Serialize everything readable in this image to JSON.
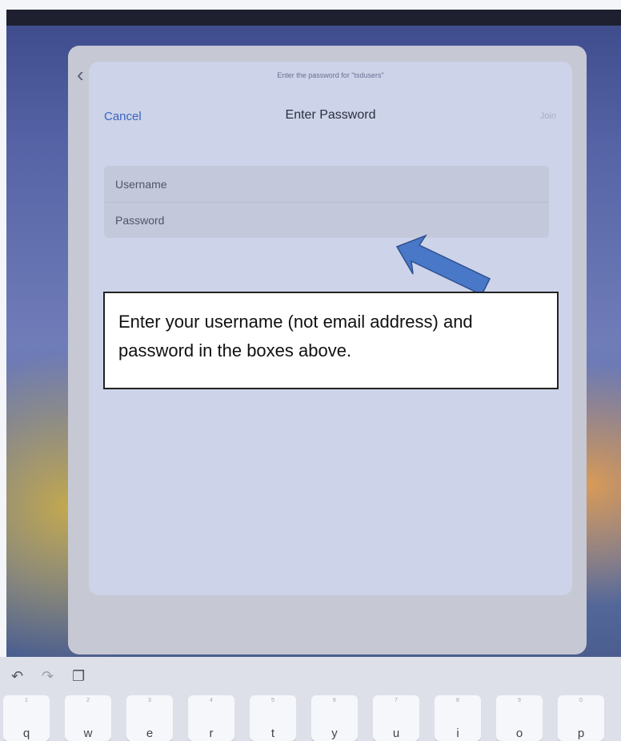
{
  "dialog": {
    "prompt": "Enter the password for \"tsdusers\"",
    "title": "Enter Password",
    "cancel_label": "Cancel",
    "join_label": "Join",
    "username_placeholder": "Username",
    "password_placeholder": "Password"
  },
  "callout": {
    "text": "Enter your username (not email address) and password in the boxes above."
  },
  "keyboard": {
    "keys": [
      "q",
      "w",
      "e",
      "r",
      "t",
      "y",
      "u",
      "i",
      "o",
      "p"
    ],
    "top_glyphs": [
      "1",
      "2",
      "3",
      "4",
      "5",
      "6",
      "7",
      "8",
      "9",
      "0"
    ]
  },
  "colors": {
    "accent": "#3a63c0",
    "arrow": "#4a78c8"
  }
}
